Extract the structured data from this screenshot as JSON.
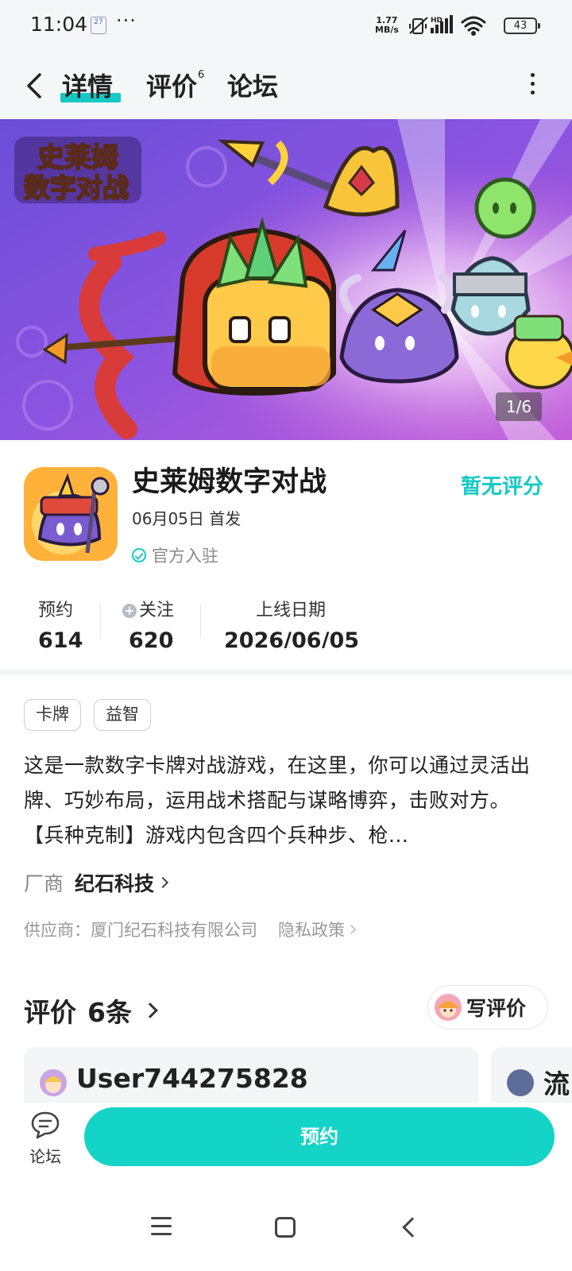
{
  "status_bar": {
    "time": "11:04",
    "calendar_day": "27",
    "more": "···",
    "speed_value": "1.77",
    "speed_unit": "MB/s",
    "hd": "HD",
    "battery": "43"
  },
  "nav": {
    "tabs": [
      {
        "label": "详情",
        "active": true
      },
      {
        "label": "评价",
        "badge": "6"
      },
      {
        "label": "论坛"
      }
    ]
  },
  "banner": {
    "logo_line1": "史莱姆",
    "logo_line2": "数字对战",
    "counter": "1/6"
  },
  "game": {
    "title": "史莱姆数字对战",
    "release": "06月05日 首发",
    "official": "官方入驻",
    "rating": "暂无评分"
  },
  "stats": [
    {
      "label": "预约",
      "value": "614"
    },
    {
      "label": "关注",
      "value": "620"
    },
    {
      "label": "上线日期",
      "value": "2026/06/05"
    }
  ],
  "tags": [
    "卡牌",
    "益智"
  ],
  "description": "这是一款数字卡牌对战游戏，在这里，你可以通过灵活出牌、巧妙布局，运用战术搭配与谋略博弈，击败对方。 【兵种克制】游戏内包含四个兵种步、枪...",
  "developer": {
    "label": "厂商",
    "name": "纪石科技"
  },
  "supplier": {
    "text": "供应商：厦门纪石科技有限公司",
    "privacy": "隐私政策"
  },
  "reviews": {
    "title": "评价",
    "count": "6条",
    "write_label": "写评价",
    "cards": [
      {
        "user": "User744275828"
      },
      {
        "user": "流"
      }
    ]
  },
  "bottom": {
    "forum_label": "论坛",
    "reserve_label": "预约"
  },
  "colors": {
    "accent": "#14c9c4",
    "reserve_button": "#14d4c8"
  }
}
